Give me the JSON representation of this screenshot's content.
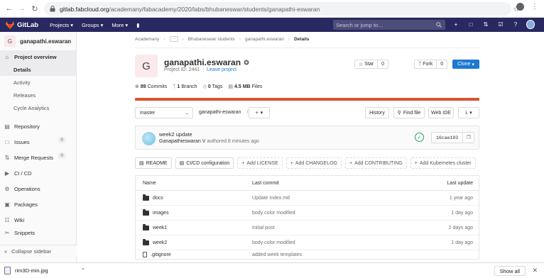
{
  "browser": {
    "url_host": "gitlab.fabcloud.org",
    "url_path": "/academany/fabacademy/2020/labs/bhubaneswar/students/ganapathi-eswaran"
  },
  "header": {
    "brand": "GitLab",
    "menu": [
      "Projects",
      "Groups",
      "More"
    ],
    "search_placeholder": "Search or jump to…"
  },
  "sidebar": {
    "project_initial": "G",
    "project_name": "ganapathi.eswaran",
    "overview_label": "Project overview",
    "overview_items": [
      "Details",
      "Activity",
      "Releases",
      "Cycle Analytics"
    ],
    "items": [
      {
        "label": "Repository",
        "icon": "repository-icon"
      },
      {
        "label": "Issues",
        "count": "0",
        "icon": "issues-icon"
      },
      {
        "label": "Merge Requests",
        "count": "0",
        "icon": "merge-requests-icon"
      },
      {
        "label": "CI / CD",
        "icon": "ci-cd-icon"
      },
      {
        "label": "Operations",
        "icon": "operations-icon"
      },
      {
        "label": "Packages",
        "icon": "packages-icon"
      },
      {
        "label": "Wiki",
        "icon": "wiki-icon"
      },
      {
        "label": "Snippets",
        "icon": "snippets-icon"
      }
    ],
    "collapse_label": "Collapse sidebar"
  },
  "breadcrumb": [
    "Academany",
    "Bhubaneswar students",
    "ganapathi.eswaran",
    "Details"
  ],
  "project": {
    "initial": "G",
    "title": "ganapathi.eswaran",
    "id_text": "Project ID: 2441",
    "leave_label": "Leave project",
    "star_label": "Star",
    "star_count": "0",
    "fork_label": "Fork",
    "fork_count": "0",
    "clone_label": "Clone"
  },
  "stats": {
    "commits": "89",
    "commits_label": "Commits",
    "branches": "1",
    "branches_label": "Branch",
    "tags": "0",
    "tags_label": "Tags",
    "size": "4.5 MB",
    "size_label": "Files"
  },
  "toolbar": {
    "branch": "master",
    "path": "ganapathi-eswaran",
    "path_sep": "/",
    "plus": "+",
    "history": "History",
    "find_file": "Find file",
    "web_ide": "Web IDE"
  },
  "commit": {
    "title": "week2 update",
    "author": "Ganapathieswaran V",
    "meta": "authored 8 minutes ago",
    "sha": "16cae193"
  },
  "quick_actions": [
    {
      "label": "README",
      "dashed": false
    },
    {
      "label": "CI/CD configuration",
      "dashed": false
    },
    {
      "label": "Add LICENSE",
      "dashed": true
    },
    {
      "label": "Add CHANGELOG",
      "dashed": true
    },
    {
      "label": "Add CONTRIBUTING",
      "dashed": true
    },
    {
      "label": "Add Kubernetes cluster",
      "dashed": true
    }
  ],
  "file_table": {
    "headers": {
      "name": "Name",
      "commit": "Last commit",
      "update": "Last update"
    },
    "rows": [
      {
        "name": "docs",
        "type": "folder",
        "commit": "Update index.md",
        "update": "1 year ago"
      },
      {
        "name": "images",
        "type": "folder",
        "commit": "body color modified",
        "update": "1 day ago"
      },
      {
        "name": "week1",
        "type": "folder",
        "commit": "Initial post",
        "update": "2 days ago"
      },
      {
        "name": "week2",
        "type": "folder",
        "commit": "body color modified",
        "update": "1 day ago"
      },
      {
        "name": ".gitignore",
        "type": "file",
        "commit": "added week templates",
        "update": ""
      }
    ]
  },
  "downloads": {
    "file": "rim3D-min.jpg",
    "show_all": "Show all"
  },
  "colors": {
    "header_bg": "#292961",
    "accent_blue": "#1f78d1",
    "language_bar": "#d9532c",
    "pipeline_success": "#1aaa55"
  }
}
